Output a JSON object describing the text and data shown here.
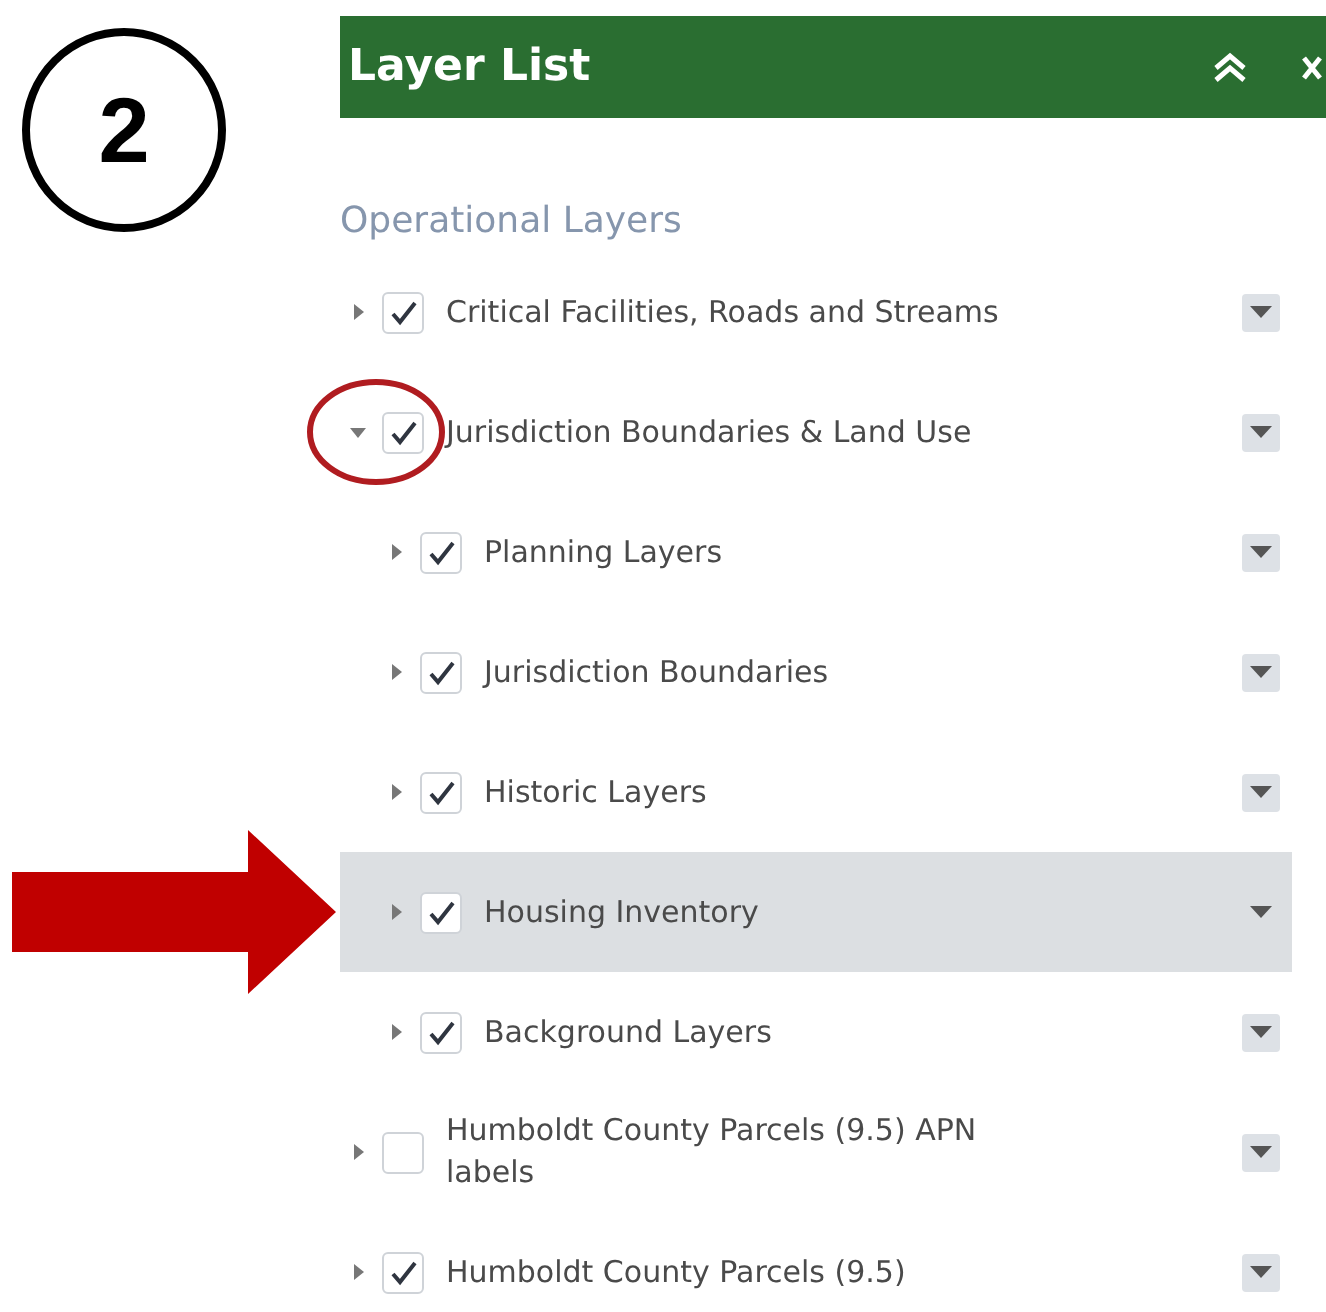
{
  "step_badge": "2",
  "panel": {
    "title": "Layer List",
    "section_heading": "Operational Layers"
  },
  "layers": [
    {
      "label": "Critical Facilities, Roads and Streams",
      "checked": true,
      "expanded": false,
      "selected": false,
      "circled": false
    },
    {
      "label": "Jurisdiction Boundaries & Land Use",
      "checked": true,
      "expanded": true,
      "selected": false,
      "circled": true,
      "children": [
        {
          "label": "Planning Layers",
          "checked": true,
          "expanded": false,
          "selected": false,
          "circled": false
        },
        {
          "label": "Jurisdiction Boundaries",
          "checked": true,
          "expanded": false,
          "selected": false,
          "circled": false
        },
        {
          "label": "Historic Layers",
          "checked": true,
          "expanded": false,
          "selected": false,
          "circled": false
        },
        {
          "label": "Housing Inventory",
          "checked": true,
          "expanded": false,
          "selected": true,
          "circled": false
        },
        {
          "label": "Background Layers",
          "checked": true,
          "expanded": false,
          "selected": false,
          "circled": false
        }
      ]
    },
    {
      "label": "Humboldt County Parcels (9.5) APN labels",
      "checked": false,
      "expanded": false,
      "selected": false,
      "circled": false
    },
    {
      "label": "Humboldt County Parcels (9.5)",
      "checked": true,
      "expanded": false,
      "selected": false,
      "circled": false
    }
  ]
}
